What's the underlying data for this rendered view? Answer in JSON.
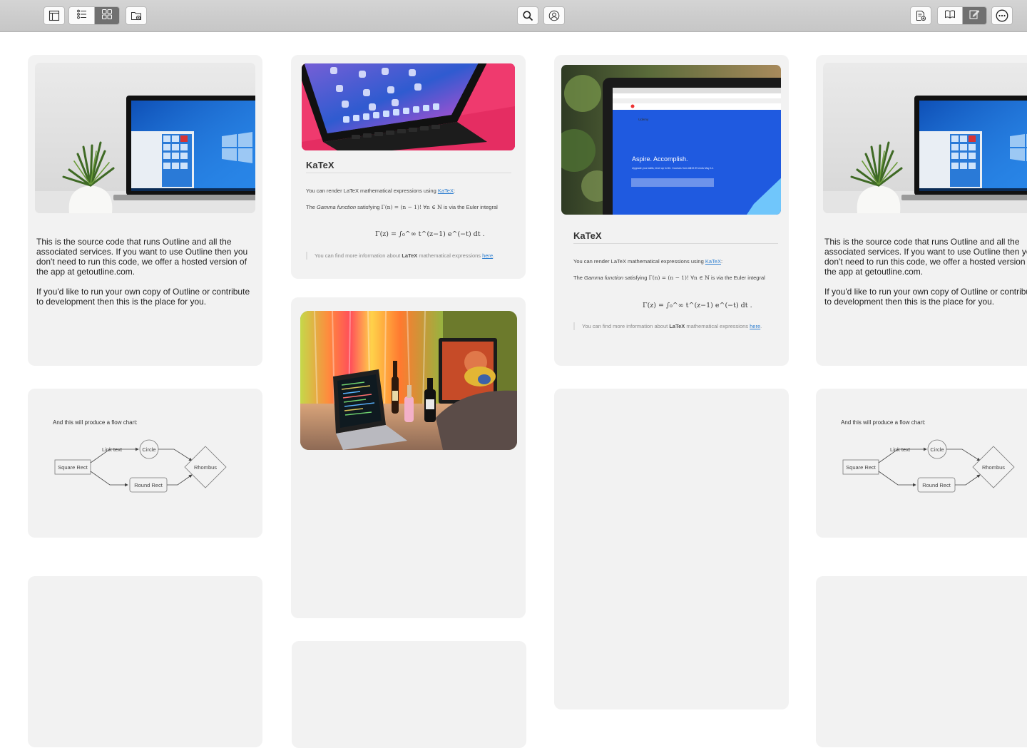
{
  "toolbar": {
    "left": [
      "sidebar-icon",
      "list-view-icon",
      "grid-view-icon",
      "new-folder-icon"
    ],
    "center": [
      "search-icon",
      "account-icon"
    ],
    "right": [
      "new-note-icon",
      "read-mode-icon",
      "edit-mode-icon",
      "more-icon"
    ],
    "active_view": "grid"
  },
  "cards": {
    "about_text": [
      "This is the source code that runs Outline and all the associated services. If you want to use Outline then you don't need to run this code, we offer a hosted version of the app at getoutline.com.",
      "If you'd like to run your own copy of Outline or contribute to development then this is the place for you."
    ],
    "katex": {
      "title": "KaTeX",
      "intro_prefix": "You can render LaTeX mathematical expressions using ",
      "intro_link": "KaTeX",
      "intro_suffix": ":",
      "gamma_prefix": "The ",
      "gamma_em": "Gamma function",
      "gamma_mid": " satisfying ",
      "gamma_expr": "Γ(n) = (n − 1)!   ∀n ∈ ℕ",
      "gamma_suffix": " is via the Euler integral",
      "formula": "Γ(z) = ∫₀^∞ t^(z−1) e^(−t) dt .",
      "quote_prefix": "You can find more information about ",
      "quote_bold": "LaTeX",
      "quote_mid": " mathematical expressions ",
      "quote_link": "here",
      "quote_suffix": "."
    },
    "flow": {
      "caption": "And this will produce a flow chart:",
      "square_rect": "Square Rect",
      "link_text": "Link text",
      "circle": "Circle",
      "round_rect": "Round Rect",
      "rhombus": "Rhombus"
    },
    "laptop_screen": {
      "headline": "Aspire. Accomplish.",
      "sub": "Upgrade your skills, level up in life. Courses from A$19.99 ends May 14.",
      "brand": "Udemy"
    }
  },
  "colors": {
    "card_bg": "#f2f2f2",
    "toolbar_bg": "#cdcdcd",
    "link": "#2f7fd0",
    "windows_blue": "#1f6fd6",
    "tablet_pink": "#f0356e",
    "udemy_blue": "#1f5ae0"
  }
}
